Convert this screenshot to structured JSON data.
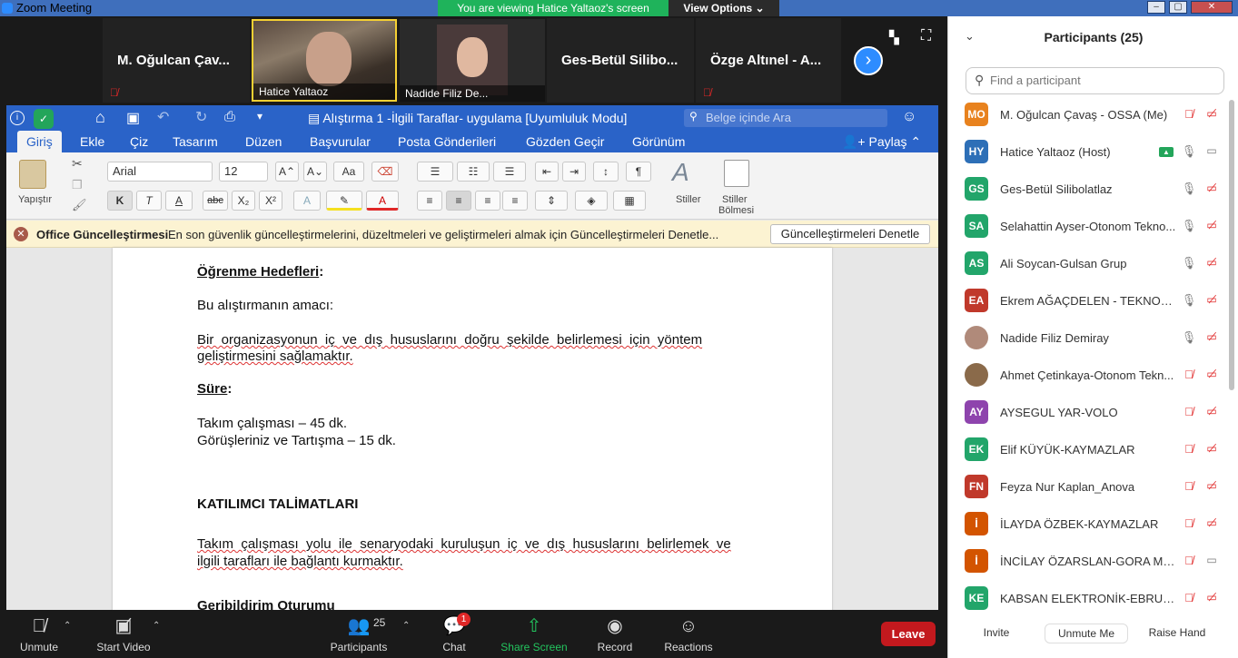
{
  "window": {
    "title": "Zoom Meeting",
    "viewing_banner": "You are viewing Hatice Yaltaoz's screen",
    "view_options": "View Options"
  },
  "video_strip": {
    "tiles": [
      {
        "name": "M. Oğulcan Çav..."
      },
      {
        "name": "Hatice Yaltaoz"
      },
      {
        "name": "Nadide Filiz De..."
      },
      {
        "name": "Ges-Betül Silibo..."
      },
      {
        "name": "Özge Altınel - A..."
      }
    ]
  },
  "word": {
    "doc_title": "Alıştırma 1 -İlgili Taraflar- uygulama [Uyumluluk Modu]",
    "search_placeholder": "Belge içinde Ara",
    "tabs": [
      "Giriş",
      "Ekle",
      "Çiz",
      "Tasarım",
      "Düzen",
      "Başvurular",
      "Posta Gönderileri",
      "Gözden Geçir",
      "Görünüm"
    ],
    "share": "Paylaş",
    "paste": "Yapıştır",
    "font": "Arial",
    "font_size": "12",
    "bold": "K",
    "italic": "T",
    "underline": "A",
    "strike": "abc",
    "sub": "X₂",
    "sup": "X²",
    "styles": "Stiller",
    "styles_pane_1": "Stiller",
    "styles_pane_2": "Bölmesi",
    "notice_title": "Office Güncelleştirmesi",
    "notice_text": "En son güvenlik güncelleştirmelerini, düzeltmeleri ve geliştirmeleri almak için Güncelleştirmeleri Denetle...",
    "notice_button": "Güncelleştirmeleri Denetle",
    "doc": {
      "h1": "Öğrenme Hedefleri",
      "h1_colon": ":",
      "p1": "Bu alıştırmanın amacı:",
      "p2a": "Bir  organizasyonun  iç  ve  dış  hususlarını  doğru  şekilde  belirlemesi  için  yöntem",
      "p2b": "geliştirmesini sağlamaktır.",
      "h2": "Süre",
      "h2_colon": ":",
      "p3": "Takım çalışması – 45 dk.",
      "p4": "Görüşleriniz ve Tartışma – 15 dk.",
      "h3": "KATILIMCI TALİMATLARI",
      "p5a": "Takım  çalışması  yolu  ile  senaryodaki  kuruluşun  iç  ve  dış  hususlarını  belirlemek  ve",
      "p5b": "ilgili tarafları ile bağlantı kurmaktır.",
      "h4": "Geribildirim Oturumu"
    }
  },
  "toolbar": {
    "unmute": "Unmute",
    "start_video": "Start Video",
    "participants": "Participants",
    "participants_count": "25",
    "chat": "Chat",
    "chat_badge": "1",
    "share_screen": "Share Screen",
    "record": "Record",
    "reactions": "Reactions",
    "leave": "Leave"
  },
  "panel": {
    "title": "Participants (25)",
    "search_placeholder": "Find a participant",
    "participants": [
      {
        "initials": "MO",
        "color": "#e8821e",
        "name": "M. Oğulcan Çavaş - OSSA (Me)",
        "mic": "muted",
        "cam": "off"
      },
      {
        "initials": "HY",
        "color": "#2d6fb7",
        "name": "Hatice Yaltaoz (Host)",
        "mic": "on",
        "cam": "on",
        "sharing": true
      },
      {
        "initials": "GS",
        "color": "#22a56a",
        "name": "Ges-Betül Silibolatlaz",
        "mic": "on",
        "cam": "off"
      },
      {
        "initials": "SA",
        "color": "#22a56a",
        "name": "Selahattin Ayser-Otonom Tekno...",
        "mic": "on",
        "cam": "off"
      },
      {
        "initials": "AS",
        "color": "#22a56a",
        "name": "Ali Soycan-Gulsan Grup",
        "mic": "on",
        "cam": "off"
      },
      {
        "initials": "EA",
        "color": "#c0392b",
        "name": "Ekrem AĞAÇDELEN - TEKNOKAR",
        "mic": "on",
        "cam": "off"
      },
      {
        "initials": "",
        "color": "#b08a7a",
        "name": "Nadide Filiz Demiray",
        "mic": "on",
        "cam": "off"
      },
      {
        "initials": "",
        "color": "#8a6a4a",
        "name": "Ahmet Çetinkaya-Otonom Tekn...",
        "mic": "muted",
        "cam": "off"
      },
      {
        "initials": "AY",
        "color": "#8e44ad",
        "name": "AYSEGUL YAR-VOLO",
        "mic": "muted",
        "cam": "off"
      },
      {
        "initials": "EK",
        "color": "#22a56a",
        "name": "Elif KÜYÜK-KAYMAZLAR",
        "mic": "muted",
        "cam": "off"
      },
      {
        "initials": "FN",
        "color": "#c0392b",
        "name": "Feyza Nur Kaplan_Anova",
        "mic": "muted",
        "cam": "off"
      },
      {
        "initials": "İ",
        "color": "#d35400",
        "name": "İLAYDA ÖZBEK-KAYMAZLAR",
        "mic": "muted",
        "cam": "off"
      },
      {
        "initials": "İ",
        "color": "#d35400",
        "name": "İNCİLAY ÖZARSLAN-GORA MAK...",
        "mic": "muted",
        "cam": "on"
      },
      {
        "initials": "KE",
        "color": "#22a56a",
        "name": "KABSAN ELEKTRONİK-EBRU-GİZ...",
        "mic": "muted",
        "cam": "off"
      }
    ],
    "invite": "Invite",
    "unmute_me": "Unmute Me",
    "raise_hand": "Raise Hand"
  }
}
